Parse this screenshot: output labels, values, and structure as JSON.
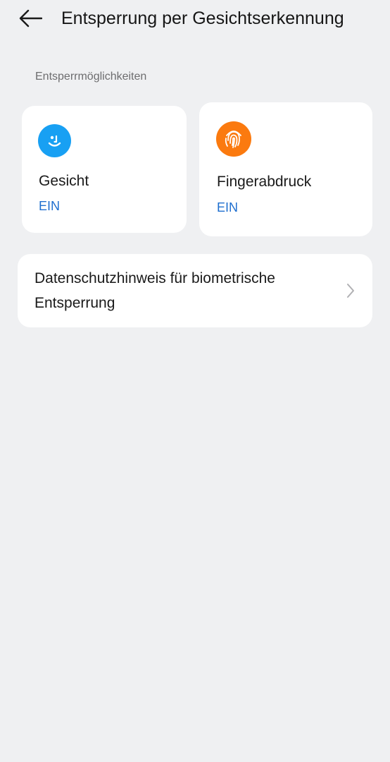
{
  "header": {
    "title": "Entsperrung per Gesichtserkennung",
    "back_icon": "arrow-left-icon"
  },
  "section": {
    "label": "Entsperrmöglichkeiten"
  },
  "cards": [
    {
      "title": "Gesicht",
      "status": "EIN",
      "icon": "face-icon",
      "icon_color": "#18a0f3"
    },
    {
      "title": "Fingerabdruck",
      "status": "EIN",
      "icon": "fingerprint-icon",
      "icon_color": "#fb7a0f"
    }
  ],
  "privacy": {
    "label": "Datenschutzhinweis für biometrische Entsperrung",
    "icon": "chevron-right-icon"
  },
  "colors": {
    "background": "#eff0f2",
    "card": "#ffffff",
    "accent_status": "#1f6fcf"
  }
}
